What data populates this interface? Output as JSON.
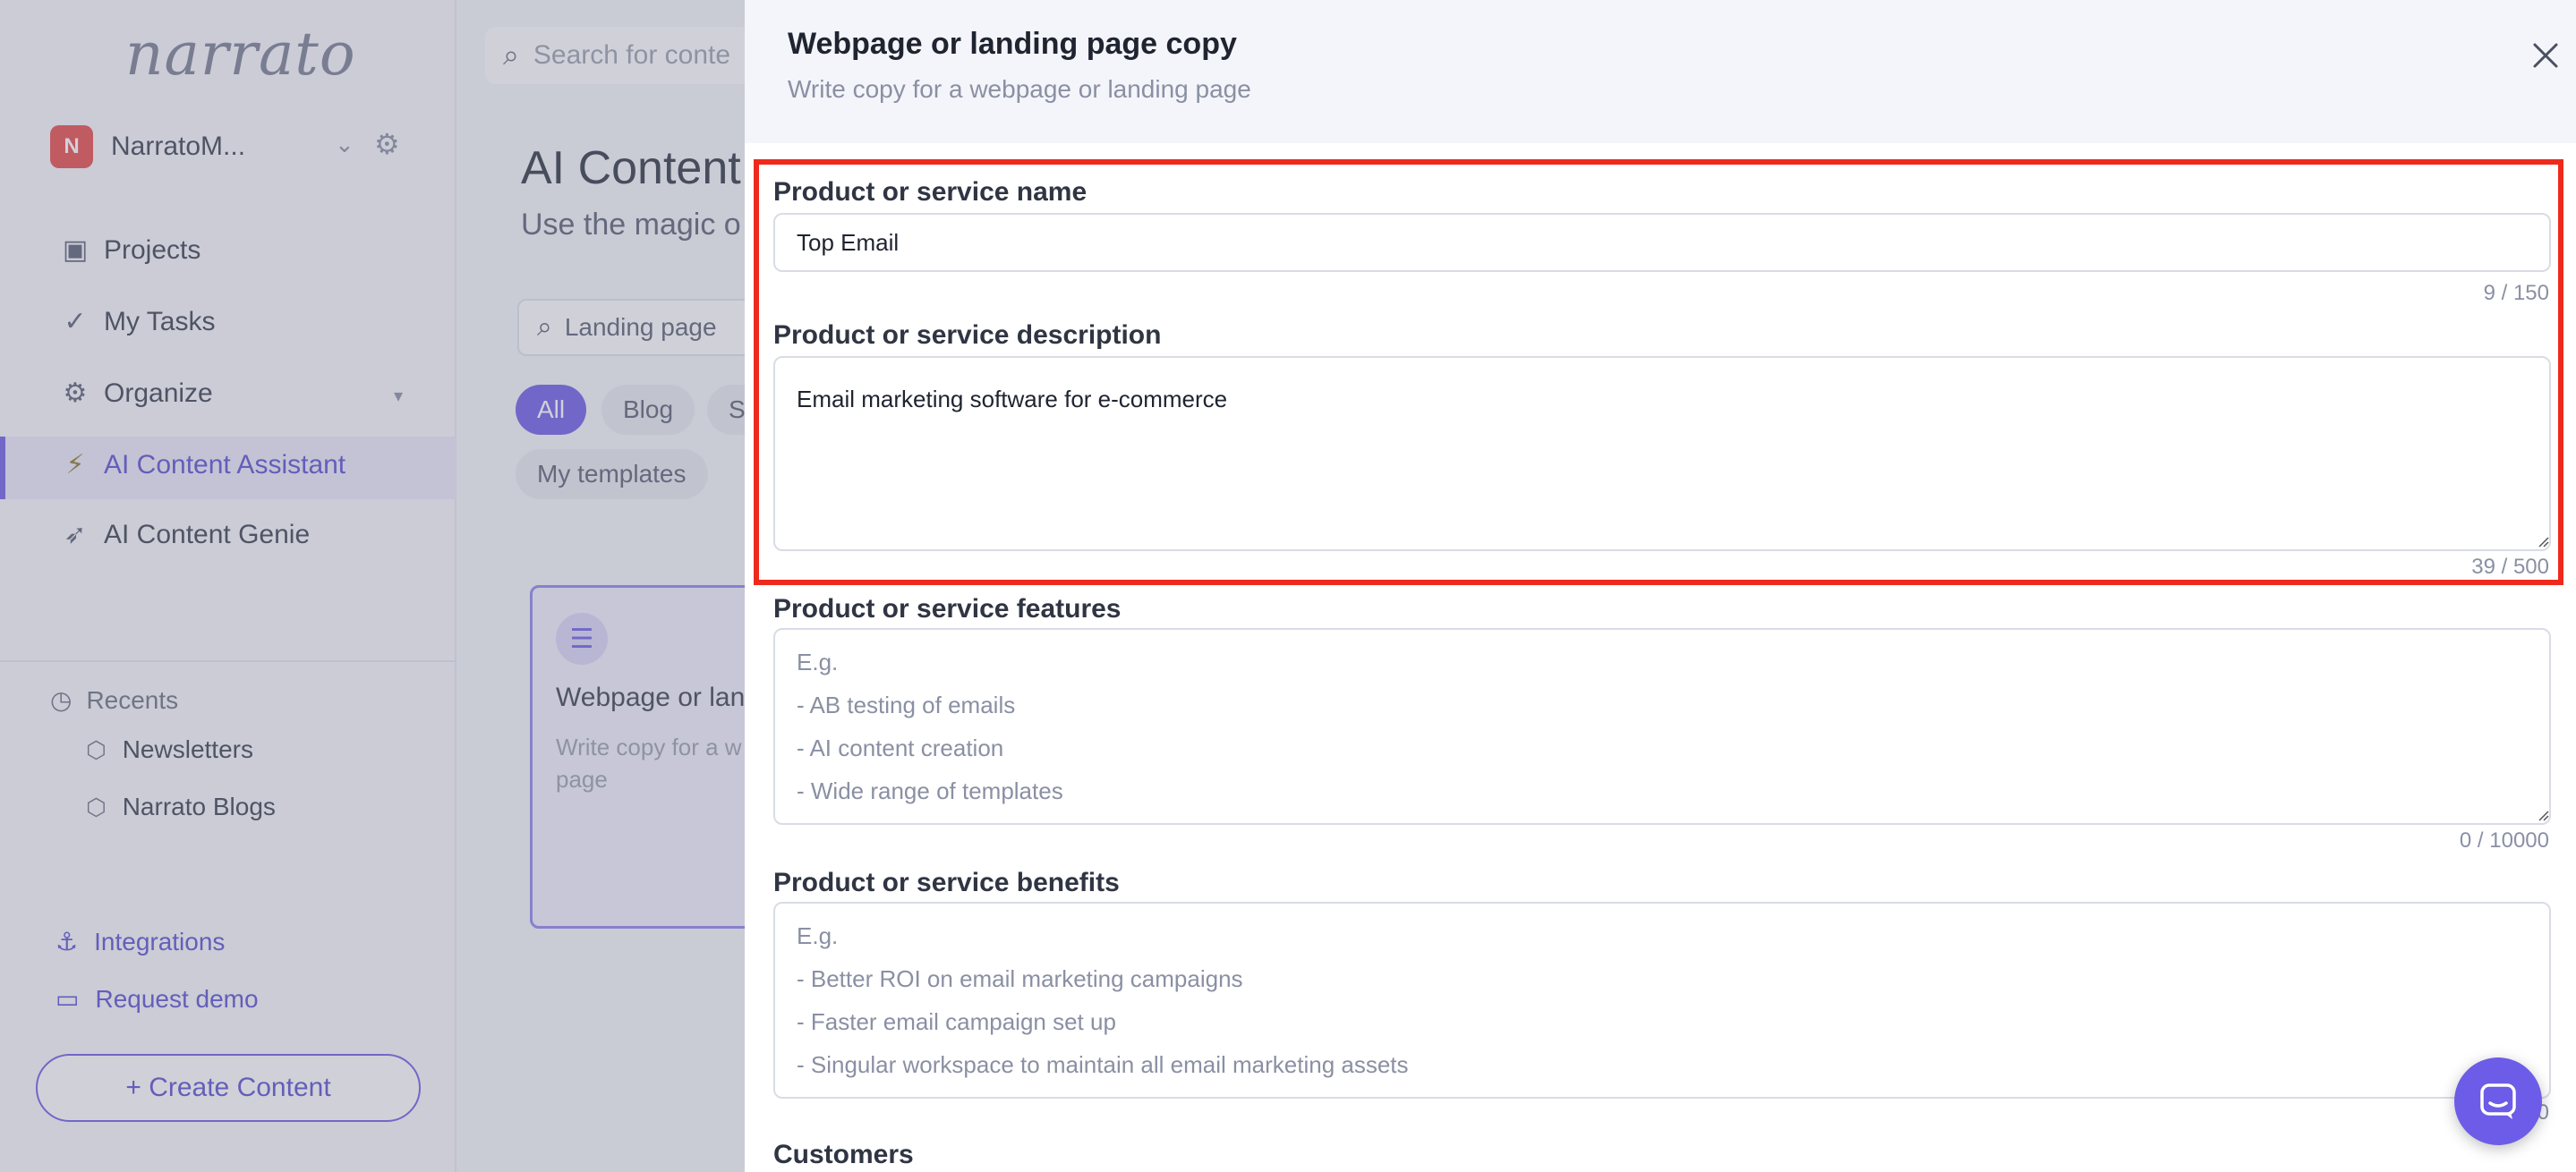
{
  "sidebar": {
    "logo": "narrato",
    "workspace": {
      "initial": "N",
      "name": "NarratoM..."
    },
    "nav": [
      {
        "label": "Projects",
        "icon": "briefcase-icon"
      },
      {
        "label": "My Tasks",
        "icon": "check-icon"
      },
      {
        "label": "Organize",
        "icon": "gears-icon"
      },
      {
        "label": "AI Content Assistant",
        "icon": "lightning-icon"
      },
      {
        "label": "AI Content Genie",
        "icon": "rocket-icon"
      }
    ],
    "recents_label": "Recents",
    "recents": [
      "Newsletters",
      "Narrato Blogs"
    ],
    "links": [
      {
        "label": "Integrations",
        "icon": "anchor-icon"
      },
      {
        "label": "Request demo",
        "icon": "monitor-icon"
      }
    ],
    "create_button": "+ Create Content"
  },
  "main": {
    "search_placeholder": "Search for conte",
    "title": "AI Content",
    "subtitle": "Use the magic o",
    "template_search": "Landing page",
    "chips": [
      "All",
      "Blog",
      "S",
      "My templates"
    ],
    "card": {
      "title": "Webpage or lan",
      "desc": "Write copy for a w page"
    }
  },
  "drawer": {
    "title": "Webpage or landing page copy",
    "subtitle": "Write copy for a webpage or landing page",
    "fields": {
      "name": {
        "label": "Product or service name",
        "value": "Top Email",
        "counter": "9 / 150"
      },
      "description": {
        "label": "Product or service description",
        "value": "Email marketing software for e-commerce",
        "counter": "39 / 500"
      },
      "features": {
        "label": "Product or service features",
        "placeholder_lines": [
          "E.g.",
          "- AB testing of emails",
          "- AI content creation",
          "- Wide range of templates"
        ],
        "counter": "0 / 10000"
      },
      "benefits": {
        "label": "Product or service benefits",
        "placeholder_lines": [
          "E.g.",
          "- Better ROI on email marketing campaigns",
          "- Faster email campaign set up",
          "- Singular workspace to maintain all email marketing assets"
        ],
        "counter": "0"
      },
      "customers": {
        "label": "Customers"
      }
    }
  },
  "colors": {
    "accent": "#6c5ce7",
    "highlight": "#ee2a1c"
  }
}
